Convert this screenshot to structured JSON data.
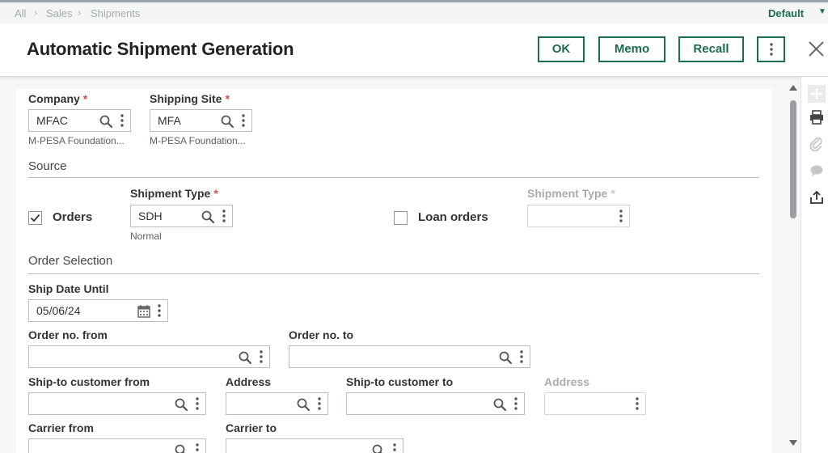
{
  "breadcrumb": [
    "All",
    "Sales",
    "Shipments"
  ],
  "view_selector": {
    "label": "Default"
  },
  "header": {
    "title": "Automatic Shipment Generation",
    "buttons": {
      "ok": "OK",
      "memo": "Memo",
      "recall": "Recall"
    }
  },
  "company": {
    "label": "Company",
    "required_mark": "*",
    "value": "MFAC",
    "description": "M-PESA Foundation..."
  },
  "shipping_site": {
    "label": "Shipping Site",
    "required_mark": "*",
    "value": "MFA",
    "description": "M-PESA Foundation..."
  },
  "source": {
    "title": "Source",
    "orders": {
      "label": "Orders",
      "checked": true
    },
    "shipment_type": {
      "label": "Shipment Type",
      "required_mark": "*",
      "value": "SDH",
      "description": "Normal"
    },
    "loan_orders": {
      "label": "Loan orders",
      "checked": false
    },
    "loan_shipment_type": {
      "label": "Shipment Type",
      "required_mark": "*",
      "value": ""
    }
  },
  "order_selection": {
    "title": "Order Selection",
    "ship_date_until": {
      "label": "Ship Date Until",
      "value": "05/06/24"
    },
    "order_no_from": {
      "label": "Order no. from",
      "value": ""
    },
    "order_no_to": {
      "label": "Order no. to",
      "value": ""
    },
    "ship_to_customer_from": {
      "label": "Ship-to customer from",
      "value": ""
    },
    "address_from": {
      "label": "Address",
      "value": ""
    },
    "ship_to_customer_to": {
      "label": "Ship-to customer to",
      "value": ""
    },
    "address_to": {
      "label": "Address",
      "value": ""
    },
    "carrier_from": {
      "label": "Carrier from",
      "value": ""
    },
    "carrier_to": {
      "label": "Carrier to",
      "value": ""
    }
  },
  "colors": {
    "accent": "#1b6e4b",
    "required": "#d74c4c"
  },
  "icons": {
    "field_lookup": "search-icon",
    "field_menu": "more-vertical-icon",
    "date": "calendar-icon",
    "sidebar": [
      "plus-icon",
      "print-icon",
      "attachment-icon",
      "comment-icon",
      "share-icon"
    ]
  }
}
